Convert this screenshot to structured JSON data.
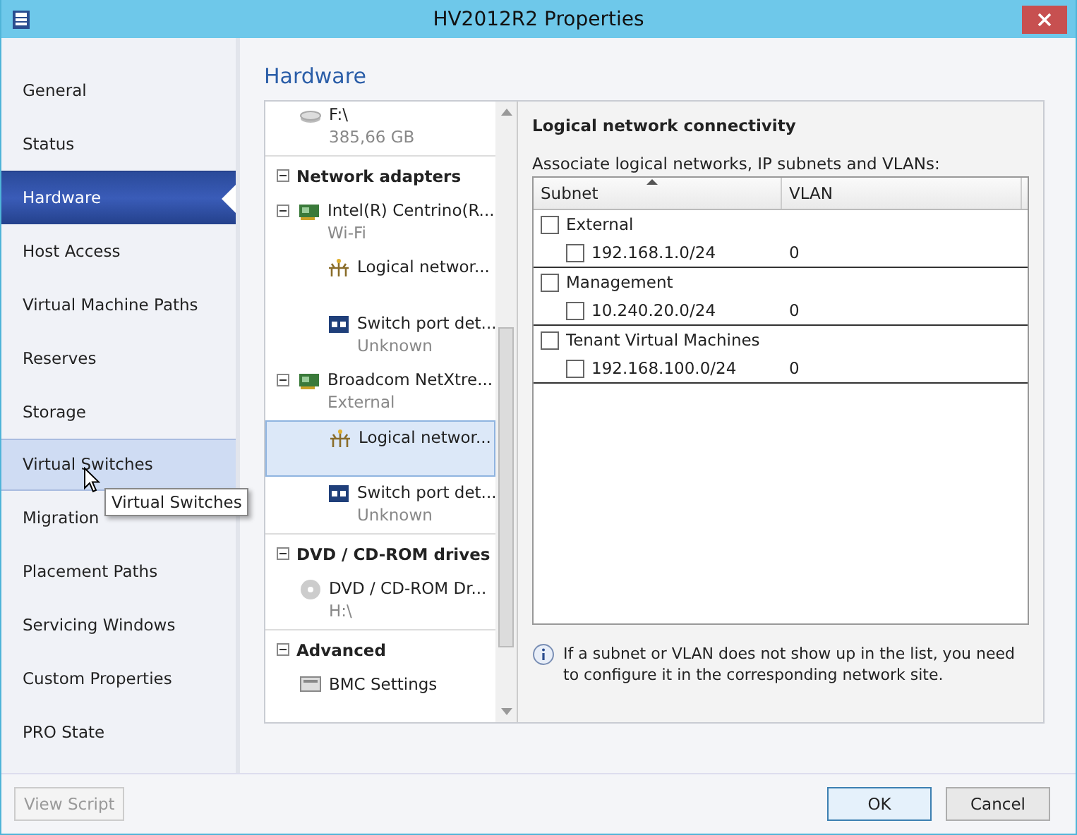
{
  "window": {
    "title": "HV2012R2 Properties"
  },
  "sidebar": {
    "items": [
      {
        "label": "General",
        "selected": false,
        "hovered": false
      },
      {
        "label": "Status",
        "selected": false,
        "hovered": false
      },
      {
        "label": "Hardware",
        "selected": true,
        "hovered": false
      },
      {
        "label": "Host Access",
        "selected": false,
        "hovered": false
      },
      {
        "label": "Virtual Machine Paths",
        "selected": false,
        "hovered": false
      },
      {
        "label": "Reserves",
        "selected": false,
        "hovered": false
      },
      {
        "label": "Storage",
        "selected": false,
        "hovered": false
      },
      {
        "label": "Virtual Switches",
        "selected": false,
        "hovered": true
      },
      {
        "label": "Migration",
        "selected": false,
        "hovered": false
      },
      {
        "label": "Placement Paths",
        "selected": false,
        "hovered": false
      },
      {
        "label": "Servicing Windows",
        "selected": false,
        "hovered": false
      },
      {
        "label": "Custom Properties",
        "selected": false,
        "hovered": false
      },
      {
        "label": "PRO State",
        "selected": false,
        "hovered": false
      }
    ]
  },
  "tooltip": {
    "text": "Virtual Switches"
  },
  "page_title": "Hardware",
  "tree": {
    "sections": [
      {
        "items": [
          {
            "kind": "drive",
            "title": "F:\\",
            "subtitle": "385,66 GB",
            "selected": false
          }
        ]
      },
      {
        "header": "Network adapters",
        "expanded": true,
        "items": [
          {
            "kind": "adapter",
            "title": "Intel(R) Centrino(R...",
            "subtitle": "Wi-Fi",
            "expanded": true,
            "selected": false,
            "children": [
              {
                "kind": "logical",
                "title": "Logical networ...",
                "selected": false
              },
              {
                "kind": "port",
                "title": "Switch port det...",
                "subtitle": "Unknown",
                "selected": false
              }
            ]
          },
          {
            "kind": "adapter",
            "title": "Broadcom NetXtre...",
            "subtitle": "External",
            "expanded": true,
            "selected": false,
            "children": [
              {
                "kind": "logical",
                "title": "Logical networ...",
                "selected": true
              },
              {
                "kind": "port",
                "title": "Switch port det...",
                "subtitle": "Unknown",
                "selected": false
              }
            ]
          }
        ]
      },
      {
        "header": "DVD / CD-ROM drives",
        "expanded": true,
        "items": [
          {
            "kind": "dvd",
            "title": "DVD / CD-ROM Dr...",
            "subtitle": "H:\\",
            "selected": false
          }
        ]
      },
      {
        "header": "Advanced",
        "expanded": true,
        "items": [
          {
            "kind": "bmc",
            "title": "BMC Settings",
            "selected": false
          }
        ]
      }
    ]
  },
  "detail": {
    "title": "Logical network connectivity",
    "caption": "Associate logical networks, IP subnets and VLANs:",
    "columns": [
      {
        "label": "Subnet",
        "sorted": true
      },
      {
        "label": "VLAN",
        "sorted": false
      }
    ],
    "groups": [
      {
        "name": "External",
        "checked": false,
        "subnets": [
          {
            "subnet": "192.168.1.0/24",
            "vlan": "0",
            "checked": false
          }
        ]
      },
      {
        "name": "Management",
        "checked": false,
        "subnets": [
          {
            "subnet": "10.240.20.0/24",
            "vlan": "0",
            "checked": false
          }
        ]
      },
      {
        "name": "Tenant Virtual Machines",
        "checked": false,
        "subnets": [
          {
            "subnet": "192.168.100.0/24",
            "vlan": "0",
            "checked": false
          }
        ]
      }
    ],
    "note": "If a subnet or VLAN does not show up in the list, you need to configure it in the corresponding network site."
  },
  "buttons": [
    {
      "label": "View Script",
      "disabled": true
    },
    {
      "label": "OK",
      "disabled": false,
      "default": true
    },
    {
      "label": "Cancel",
      "disabled": false,
      "default": false
    }
  ]
}
